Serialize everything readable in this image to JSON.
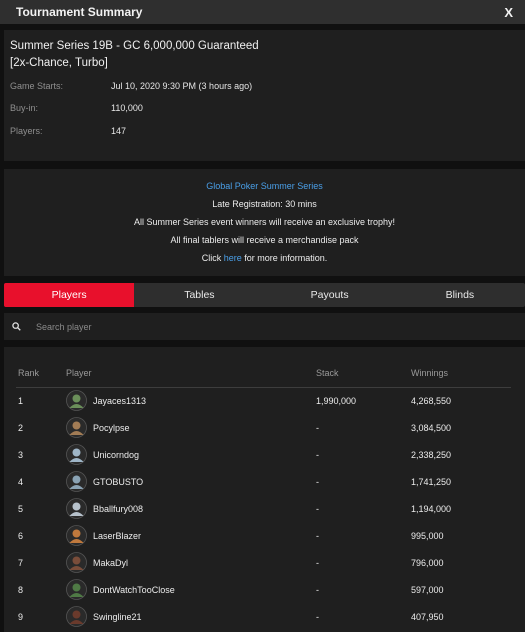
{
  "window": {
    "title": "Tournament Summary",
    "close_label": "X"
  },
  "summary": {
    "event_name": "Summer Series 19B - GC 6,000,000 Guaranteed [2x-Chance, Turbo]",
    "game_starts_label": "Game Starts:",
    "game_starts_value": "Jul 10, 2020 9:30 PM (3 hours ago)",
    "buyin_label": "Buy-in:",
    "buyin_value": "110,000",
    "players_label": "Players:",
    "players_value": "147"
  },
  "promo": {
    "series_link": "Global Poker Summer Series",
    "late_reg": "Late Registration: 30 mins",
    "line_trophy": "All Summer Series event winners will receive an exclusive trophy!",
    "line_merch": "All final tablers will receive a merchandise pack",
    "click_prefix": "Click",
    "click_link": "here",
    "click_suffix": "for more information."
  },
  "tabs": [
    {
      "label": "Players",
      "active": true
    },
    {
      "label": "Tables",
      "active": false
    },
    {
      "label": "Payouts",
      "active": false
    },
    {
      "label": "Blinds",
      "active": false
    }
  ],
  "search": {
    "placeholder": "Search player",
    "icon": "search-icon"
  },
  "table": {
    "headers": {
      "rank": "Rank",
      "player": "Player",
      "stack": "Stack",
      "winnings": "Winnings"
    },
    "rows": [
      {
        "rank": "1",
        "player": "Jayaces1313",
        "stack": "1,990,000",
        "winnings": "4,268,550",
        "avatar_color": "#6b8f5a"
      },
      {
        "rank": "2",
        "player": "Pocylpse",
        "stack": "-",
        "winnings": "3,084,500",
        "avatar_color": "#a27c55"
      },
      {
        "rank": "3",
        "player": "Unicorndog",
        "stack": "-",
        "winnings": "2,338,250",
        "avatar_color": "#9fb6c8"
      },
      {
        "rank": "4",
        "player": "GTOBUSTO",
        "stack": "-",
        "winnings": "1,741,250",
        "avatar_color": "#8aa3b5"
      },
      {
        "rank": "5",
        "player": "Bballfury008",
        "stack": "-",
        "winnings": "1,194,000",
        "avatar_color": "#b7c2cc"
      },
      {
        "rank": "6",
        "player": "LaserBlazer",
        "stack": "-",
        "winnings": "995,000",
        "avatar_color": "#c0793d"
      },
      {
        "rank": "7",
        "player": "MakaDyl",
        "stack": "-",
        "winnings": "796,000",
        "avatar_color": "#7a4d3a"
      },
      {
        "rank": "8",
        "player": "DontWatchTooClose",
        "stack": "-",
        "winnings": "597,000",
        "avatar_color": "#4f7a45"
      },
      {
        "rank": "9",
        "player": "Swingline21",
        "stack": "-",
        "winnings": "407,950",
        "avatar_color": "#6a3a2c"
      }
    ]
  },
  "colors": {
    "accent": "#e8102c",
    "link": "#4a9fe8",
    "panel": "#1f1f1f",
    "background": "#101010"
  }
}
